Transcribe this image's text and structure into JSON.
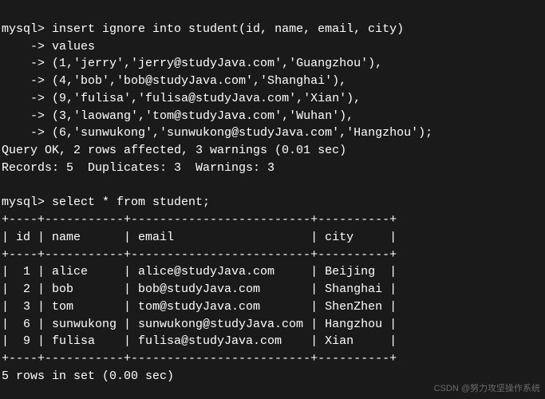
{
  "prompt": "mysql>",
  "cont": "    ->",
  "insert": {
    "head": " insert ignore into student(id, name, email, city)",
    "values_kw": " values",
    "rows": [
      " (1,'jerry','jerry@studyJava.com','Guangzhou'),",
      " (4,'bob','bob@studyJava.com','Shanghai'),",
      " (9,'fulisa','fulisa@studyJava.com','Xian'),",
      " (3,'laowang','tom@studyJava.com','Wuhan'),",
      " (6,'sunwukong','sunwukong@studyJava.com','Hangzhou');"
    ]
  },
  "insert_result": {
    "line1": "Query OK, 2 rows affected, 3 warnings (0.01 sec)",
    "line2": "Records: 5  Duplicates: 3  Warnings: 3"
  },
  "select": {
    "cmd": " select * from student;"
  },
  "table": {
    "border": "+----+-----------+-------------------------+----------+",
    "header": "| id | name      | email                   | city     |",
    "rows": [
      "|  1 | alice     | alice@studyJava.com     | Beijing  |",
      "|  2 | bob       | bob@studyJava.com       | Shanghai |",
      "|  3 | tom       | tom@studyJava.com       | ShenZhen |",
      "|  6 | sunwukong | sunwukong@studyJava.com | Hangzhou |",
      "|  9 | fulisa    | fulisa@studyJava.com    | Xian     |"
    ]
  },
  "select_result": "5 rows in set (0.00 sec)",
  "watermark": "CSDN @努力攻坚操作系统"
}
